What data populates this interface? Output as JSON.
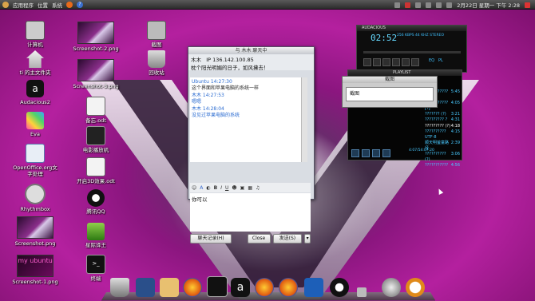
{
  "topbar": {
    "menus": [
      "应用程序",
      "位置",
      "系统"
    ],
    "datetime": "2月22日 星期一 下午 2:28",
    "user_icon": "user-icon"
  },
  "desktop_left": [
    {
      "label": "计算机",
      "icon": "computer-icon"
    },
    {
      "label": "ti 的主文件夹",
      "icon": "home-folder-icon"
    },
    {
      "label": "Audacious2",
      "icon": "audacious-icon"
    },
    {
      "label": "Eva",
      "icon": "eva-icon"
    },
    {
      "label": "OpenOffice.org文字处理",
      "icon": "writer-icon"
    },
    {
      "label": "Rhythmbox",
      "icon": "rhythmbox-icon"
    },
    {
      "label": "Screenshot.png",
      "icon": "image-thumb-icon"
    },
    {
      "label": "Screenshot-1.png",
      "icon": "image-thumb-icon"
    }
  ],
  "desktop_col2": [
    {
      "label": "Screenshot-2.png"
    },
    {
      "label": "Screenshot-3.png"
    },
    {
      "label": "备忘.odt"
    },
    {
      "label": "电影播放机"
    },
    {
      "label": "开启3D效果.odt"
    },
    {
      "label": "腾讯QQ"
    },
    {
      "label": "星际译王"
    },
    {
      "label": "终端"
    }
  ],
  "desktop_col3": [
    {
      "label": "截图"
    },
    {
      "label": "回收站"
    }
  ],
  "chat": {
    "title": "与 木木 聊天中",
    "contact": "木木",
    "ip_label": "IP",
    "ip": "136.142.100.85",
    "status": "枕个阳光明媚的日子，如风拂去！",
    "messages": [
      {
        "text": "Ubuntu 14:27:30",
        "cls": "nm"
      },
      {
        "text": "这个界面和苹果电脑的系统一样",
        "cls": "mt"
      },
      {
        "text": "木木 14:27:53",
        "cls": "nm"
      },
      {
        "text": "嗯嗯",
        "cls": "bl"
      },
      {
        "text": "木木 14:28:04",
        "cls": "nm"
      },
      {
        "text": "没见过苹果电脑的系统",
        "cls": "bl"
      }
    ],
    "input_text": "你可以",
    "history_button": "聊天记录(H)",
    "close_button": "Close",
    "send_button": "发送(S)"
  },
  "audacious": {
    "title": "AUDACIOUS",
    "time": "02:52",
    "info_line1": "256 KBPS   44 KHZ   STEREO",
    "eq_label": "EQ",
    "pl_label": "PL"
  },
  "playlist": {
    "title": "PLAYLIST",
    "rows": [
      {
        "title": "??????????? [?]",
        "time": "5:45"
      },
      {
        "title": "??????????? [?]",
        "time": "4:05"
      },
      {
        "title": "??????? (?)",
        "time": "3:21"
      },
      {
        "title": "????????? ?",
        "time": "4:31"
      },
      {
        "title": "????????? (?)",
        "time": "4:18"
      },
      {
        "title": "?????????? UTF-8",
        "time": "4:15"
      },
      {
        "title": "顺天明萤童路径",
        "time": "2:39"
      },
      {
        "title": "?????????? (?)",
        "time": "3:06"
      },
      {
        "title": "???????????",
        "time": "4:56"
      }
    ],
    "position": "4:07/54:07:20"
  },
  "popup": {
    "title": "截图",
    "body": "截图"
  }
}
